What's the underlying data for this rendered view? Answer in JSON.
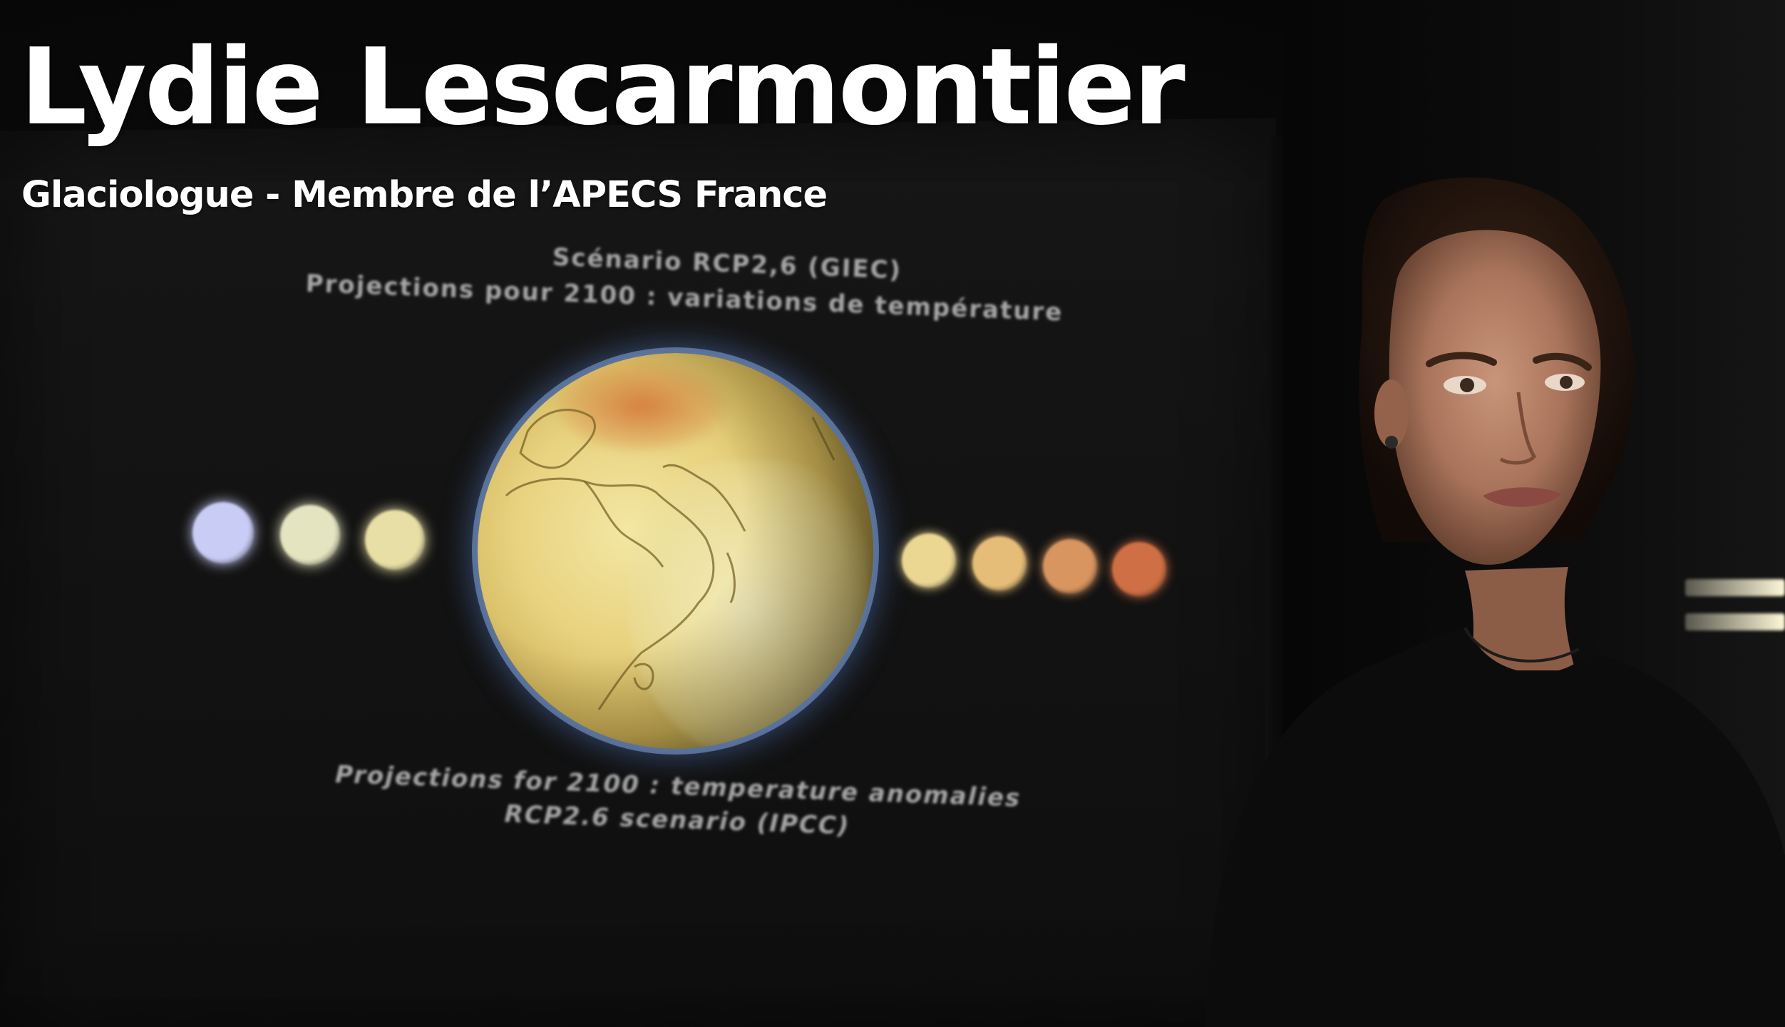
{
  "overlay": {
    "name": "Lydie Lescarmontier",
    "role": "Glaciologue - Membre de l’APECS France"
  },
  "slide": {
    "title_fr_line1": "Scénario RCP2,6 (GIEC)",
    "title_fr_line2": "Projections pour 2100 : variations de température",
    "title_en_line1": "Projections for 2100 : temperature anomalies",
    "title_en_line2": "RCP2.6 scenario (IPCC)"
  },
  "colors": {
    "overlay_text": "#ffffff",
    "background": "#050505",
    "slide_text": "#d7d7d7",
    "globe_glow": "#82afff",
    "dots_left": [
      "#c9cdf6",
      "#e4e4c0",
      "#e8dfa6"
    ],
    "dots_right": [
      "#ecd792",
      "#e6bd78",
      "#d9955f",
      "#cf6f45"
    ]
  }
}
